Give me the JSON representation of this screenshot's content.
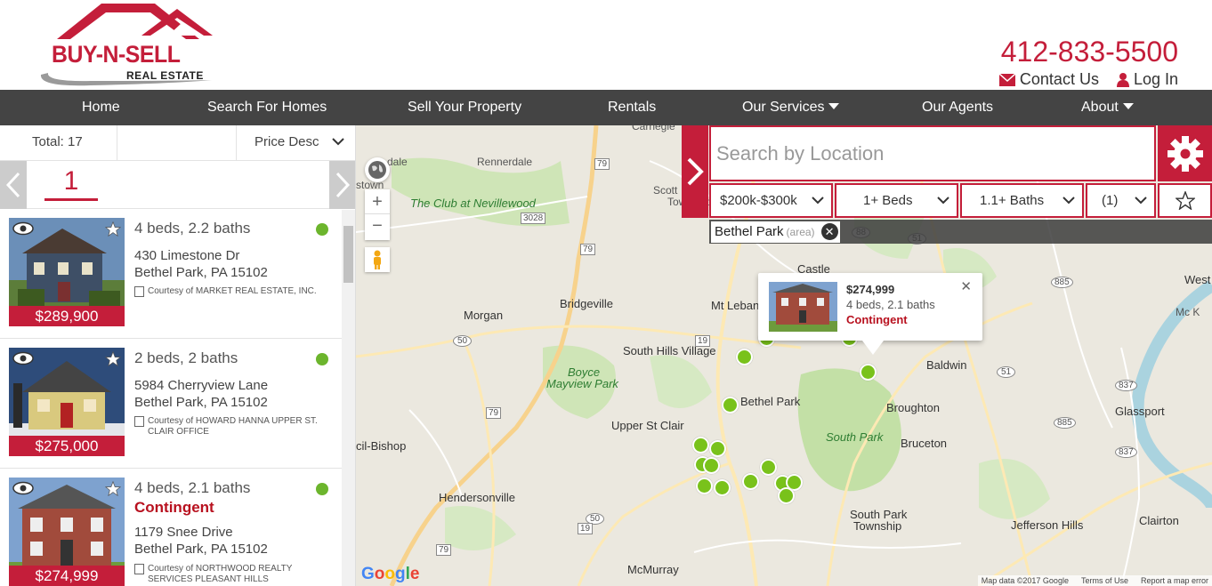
{
  "brand": {
    "logo_main": "BUY-N-SELL",
    "logo_sub": "REAL ESTATE",
    "color": "#c41e3a"
  },
  "header": {
    "phone": "412-833-5500",
    "contact_label": "Contact Us",
    "login_label": "Log In"
  },
  "nav": {
    "home": "Home",
    "search": "Search For Homes",
    "sell": "Sell Your Property",
    "rentals": "Rentals",
    "services": "Our Services",
    "agents": "Our Agents",
    "about": "About"
  },
  "sidebar": {
    "total": "Total: 17",
    "sort": "Price Desc",
    "page": "1",
    "listings": [
      {
        "title": "4 beds, 2.2 baths",
        "status": "",
        "street": "430 Limestone Dr",
        "city": "Bethel Park, PA 15102",
        "courtesy": "Courtesy of MARKET REAL ESTATE, INC.",
        "price": "$289,900"
      },
      {
        "title": "2 beds, 2 baths",
        "status": "",
        "street": "5984 Cherryview Lane",
        "city": "Bethel Park, PA 15102",
        "courtesy": "Courtesy of HOWARD HANNA UPPER ST. CLAIR OFFICE",
        "price": "$275,000"
      },
      {
        "title": "4 beds, 2.1 baths",
        "status": "Contingent",
        "street": "1179 Snee Drive",
        "city": "Bethel Park, PA 15102",
        "courtesy": "Courtesy of NORTHWOOD REALTY SERVICES PLEASANT HILLS",
        "price": "$274,999"
      }
    ]
  },
  "search": {
    "placeholder": "Search by Location",
    "price": "$200k-$300k",
    "beds": "1+ Beds",
    "baths": "1.1+ Baths",
    "more": "(1)",
    "tag_name": "Bethel Park",
    "tag_type": "(area)"
  },
  "popup": {
    "price": "$274,999",
    "beds": "4 beds, 2.1 baths",
    "status": "Contingent"
  },
  "map": {
    "labels": {
      "carnegie": "Carnegie",
      "rennerdale": "Rennerdale",
      "dale": "dale",
      "stown": "stown",
      "club": "The Club at Nevillewood",
      "scott": "Scott",
      "township": "Township",
      "castle": "Castle",
      "bridgeville": "Bridgeville",
      "morgan": "Morgan",
      "mtleb": "Mt Lebanon",
      "shv": "South Hills Village",
      "boyce": "Boyce",
      "mayview": "Mayview Park",
      "bethel": "Bethel Park",
      "baldwin": "Baldwin",
      "broughton": "Broughton",
      "upperstclair": "Upper St Clair",
      "southpark": "South Park",
      "bruceton": "Bruceton",
      "glassport": "Glassport",
      "cilbishop": "cil-Bishop",
      "hendersonville": "Hendersonville",
      "sptownship1": "South Park",
      "sptownship2": "Township",
      "jefferson": "Jefferson Hills",
      "clairton": "Clairton",
      "mcmurray": "McMurray",
      "west": "West",
      "mckeesport": "Mc K"
    },
    "routes": {
      "r79a": "79",
      "r79b": "79",
      "r79c": "79",
      "r79d": "79",
      "r50a": "50",
      "r50b": "50",
      "r19a": "19",
      "r19b": "19",
      "r3028": "3028",
      "r88": "88",
      "r51a": "51",
      "r51b": "51",
      "r885a": "885",
      "r885b": "885",
      "r837a": "837",
      "r837b": "837"
    },
    "attribution_data": "Map data ©2017 Google",
    "attribution_terms": "Terms of Use",
    "attribution_report": "Report a map error",
    "google": "Google"
  }
}
